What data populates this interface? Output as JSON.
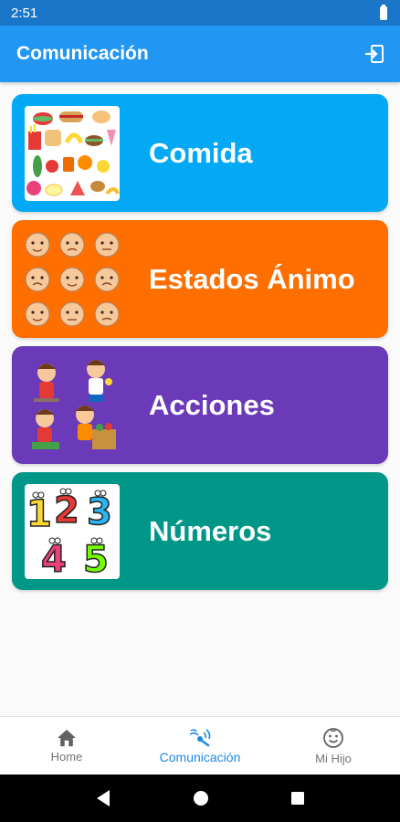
{
  "status": {
    "time": "2:51"
  },
  "header": {
    "title": "Comunicación"
  },
  "categories": [
    {
      "label": "Comida",
      "color": "#03a9f4",
      "icon": "food-collage"
    },
    {
      "label": "Estados Ánimo",
      "color": "#ff6f00",
      "icon": "faces-grid"
    },
    {
      "label": "Acciones",
      "color": "#6a3ab8",
      "icon": "kids-activities"
    },
    {
      "label": "Números",
      "color": "#009688",
      "icon": "colorful-numbers"
    }
  ],
  "bottom_nav": [
    {
      "label": "Home",
      "icon": "home-icon",
      "active": false
    },
    {
      "label": "Comunicación",
      "icon": "communication-icon",
      "active": true
    },
    {
      "label": "Mi Hijo",
      "icon": "smiley-icon",
      "active": false
    }
  ],
  "colors": {
    "primary": "#2196f3",
    "status_bar": "#1976c9",
    "nav_active": "#1e88e5"
  }
}
